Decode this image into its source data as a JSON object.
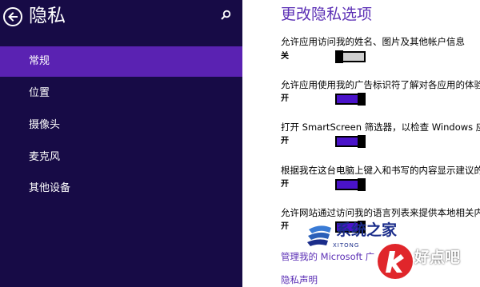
{
  "header": {
    "title": "隐私",
    "back_icon": "back-arrow-icon",
    "search_icon": "search-icon"
  },
  "nav": {
    "items": [
      {
        "label": "常规",
        "selected": true
      },
      {
        "label": "位置",
        "selected": false
      },
      {
        "label": "摄像头",
        "selected": false
      },
      {
        "label": "麦克风",
        "selected": false
      },
      {
        "label": "其他设备",
        "selected": false
      }
    ]
  },
  "main": {
    "title": "更改隐私选项",
    "settings": [
      {
        "description": "允许应用访问我的姓名、图片及其他帐户信息",
        "state": "关",
        "on": false
      },
      {
        "description": "允许应用使用我的广告标识符了解对各应用的体验",
        "state": "开",
        "on": true
      },
      {
        "description": "打开 SmartScreen 筛选器，以检查 Windows 应用",
        "state": "开",
        "on": true
      },
      {
        "description": "根据我在这台电脑上键入和书写的内容显示建议的",
        "state": "开",
        "on": true
      },
      {
        "description": "允许网站通过访问我的语言列表来提供本地相关内",
        "state": "开",
        "on": true
      }
    ],
    "links": [
      {
        "label": "管理我的 Microsoft 广"
      },
      {
        "label": "隐私声明"
      }
    ]
  },
  "watermarks": {
    "system_logo_text": "系统之家",
    "system_logo_sub": "XITONG",
    "haodianba_text": "好点吧"
  },
  "colors": {
    "nav_background": "#170b46",
    "nav_selected": "#5a22b2",
    "accent": "#5b2fb5",
    "toggle_on": "#4a13c9",
    "toggle_off": "#cfcfcf"
  }
}
